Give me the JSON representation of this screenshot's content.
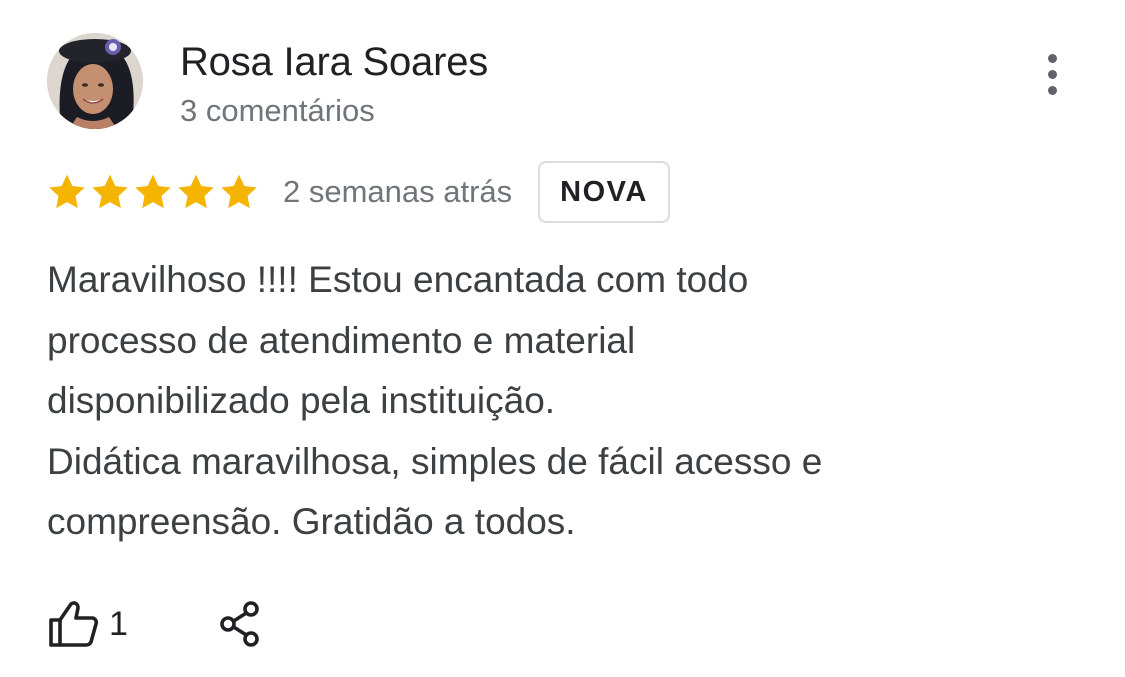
{
  "review": {
    "author_name": "Rosa Iara Soares",
    "author_meta": "3 comentários",
    "rating": 5,
    "rating_max": 5,
    "time_ago": "2 semanas atrás",
    "badge": "NOVA",
    "text": "Maravilhoso !!!! Estou encantada com todo\nprocesso de atendimento e material\ndisponibilizado pela instituição.\nDidática maravilhosa, simples de fácil acesso e\ncompreensão. Gratidão a todos.",
    "likes": "1"
  },
  "icons": {
    "avatar": "avatar-photo",
    "more": "more-vertical-icon",
    "star": "star-icon",
    "like": "thumbs-up-icon",
    "share": "share-icon"
  },
  "colors": {
    "star": "#f4b400",
    "text_primary": "#202124",
    "text_secondary": "#70757a",
    "badge_border": "#dadce0"
  }
}
